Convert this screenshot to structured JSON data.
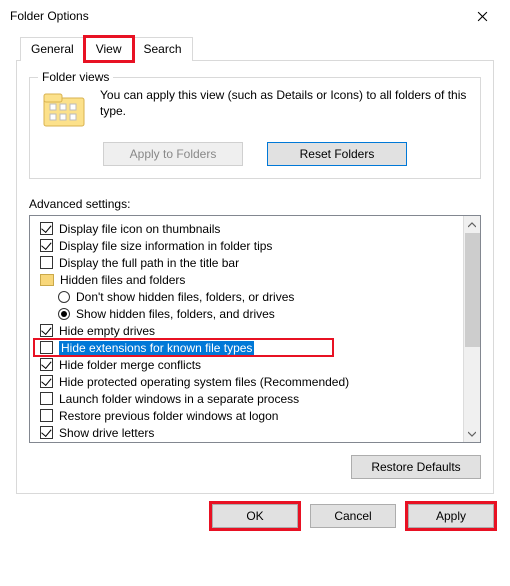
{
  "window": {
    "title": "Folder Options"
  },
  "tabs": {
    "general": "General",
    "view": "View",
    "search": "Search"
  },
  "folderViews": {
    "groupTitle": "Folder views",
    "text": "You can apply this view (such as Details or Icons) to all folders of this type.",
    "applyBtn": "Apply to Folders",
    "resetBtn": "Reset Folders"
  },
  "advanced": {
    "label": "Advanced settings:",
    "items": [
      {
        "type": "check",
        "checked": true,
        "text": "Display file icon on thumbnails"
      },
      {
        "type": "check",
        "checked": true,
        "text": "Display file size information in folder tips"
      },
      {
        "type": "check",
        "checked": false,
        "text": "Display the full path in the title bar"
      },
      {
        "type": "folder",
        "text": "Hidden files and folders"
      },
      {
        "type": "radio",
        "checked": false,
        "indent": true,
        "text": "Don't show hidden files, folders, or drives"
      },
      {
        "type": "radio",
        "checked": true,
        "indent": true,
        "text": "Show hidden files, folders, and drives"
      },
      {
        "type": "check",
        "checked": true,
        "text": "Hide empty drives"
      },
      {
        "type": "check",
        "checked": false,
        "selected": true,
        "text": "Hide extensions for known file types"
      },
      {
        "type": "check",
        "checked": true,
        "text": "Hide folder merge conflicts"
      },
      {
        "type": "check",
        "checked": true,
        "text": "Hide protected operating system files (Recommended)"
      },
      {
        "type": "check",
        "checked": false,
        "text": "Launch folder windows in a separate process"
      },
      {
        "type": "check",
        "checked": false,
        "text": "Restore previous folder windows at logon"
      },
      {
        "type": "check",
        "checked": true,
        "text": "Show drive letters"
      }
    ],
    "restoreBtn": "Restore Defaults"
  },
  "buttons": {
    "ok": "OK",
    "cancel": "Cancel",
    "apply": "Apply"
  }
}
